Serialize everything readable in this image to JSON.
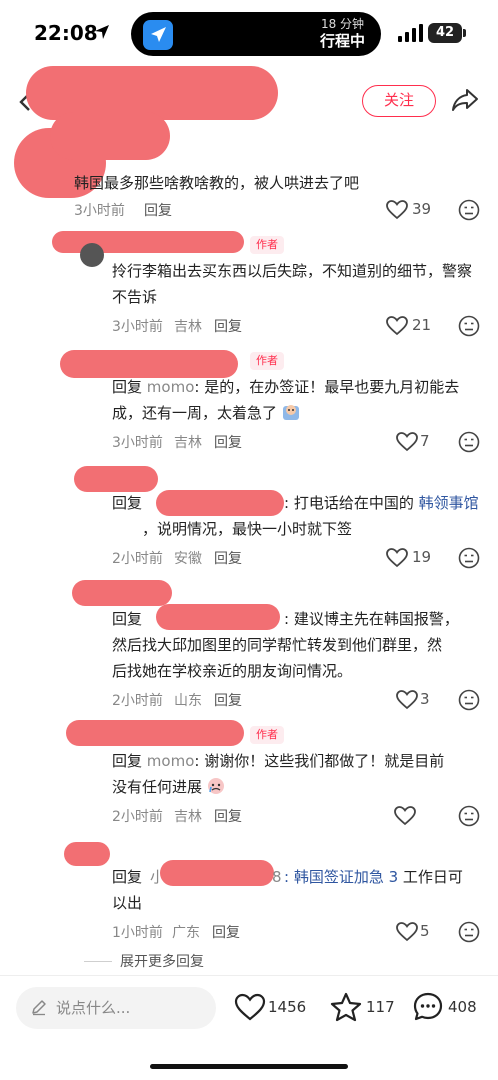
{
  "status_bar": {
    "time": "22:08",
    "eta_minutes": "18 分钟",
    "eta_label": "行程中",
    "battery": "42"
  },
  "header": {
    "follow_label": "关注"
  },
  "comments": [
    {
      "text": "韩国最多那些啥教啥教的，被人哄进去了吧",
      "time": "3小时前",
      "location": "",
      "reply_label": "回复",
      "likes": "39"
    },
    {
      "author_tag": "作者",
      "text": "拎行李箱出去买东西以后失踪，不知道别的细节，警察不告诉",
      "time": "3小时前",
      "location": "吉林",
      "reply_label": "回复",
      "likes": "21"
    },
    {
      "author_tag": "作者",
      "reply_prefix": "回复",
      "reply_to": "momo",
      "text": ": 是的，在办签证！最早也要九月初能去成，还有一周，太着急了",
      "time": "3小时前",
      "location": "吉林",
      "reply_label": "回复",
      "likes": "7"
    },
    {
      "reply_prefix": "回复",
      "text_line1_a": ": 打电话给在中国的",
      "link": "韩领事馆",
      "text_line2": "，说明情况，最快一小时就下签",
      "time": "2小时前",
      "location": "安徽",
      "reply_label": "回复",
      "likes": "19"
    },
    {
      "reply_prefix": "回复",
      "text_line1": ": 建议博主先在韩国报警，",
      "text_line2": "然后找大邱加图里的同学帮忙转发到他们群里，然",
      "text_line3": "后找她在学校亲近的朋友询问情况。",
      "time": "2小时前",
      "location": "山东",
      "reply_label": "回复",
      "likes": "3"
    },
    {
      "author_tag": "作者",
      "reply_prefix": "回复",
      "reply_to": "momo",
      "text_line1": ": 谢谢你！这些我们都做了！就是目前",
      "text_line2": "没有任何进展",
      "time": "2小时前",
      "location": "吉林",
      "reply_label": "回复",
      "likes": ""
    },
    {
      "reply_prefix": "回复",
      "name_fragment_a": "小",
      "name_fragment_b": "8",
      "link": "韩国签证加急 3",
      "text_line1": " 工作日可",
      "text_line2": "以出",
      "time": "1小时前",
      "location": "广东",
      "reply_label": "回复",
      "likes": "5"
    }
  ],
  "expand_label": "展开更多回复",
  "bottom_bar": {
    "input_placeholder": "说点什么...",
    "likes": "1456",
    "stars": "117",
    "comments": "408"
  },
  "colors": {
    "accent": "#ff2e4d",
    "link": "#2f56a0",
    "redaction": "#f26f73"
  }
}
